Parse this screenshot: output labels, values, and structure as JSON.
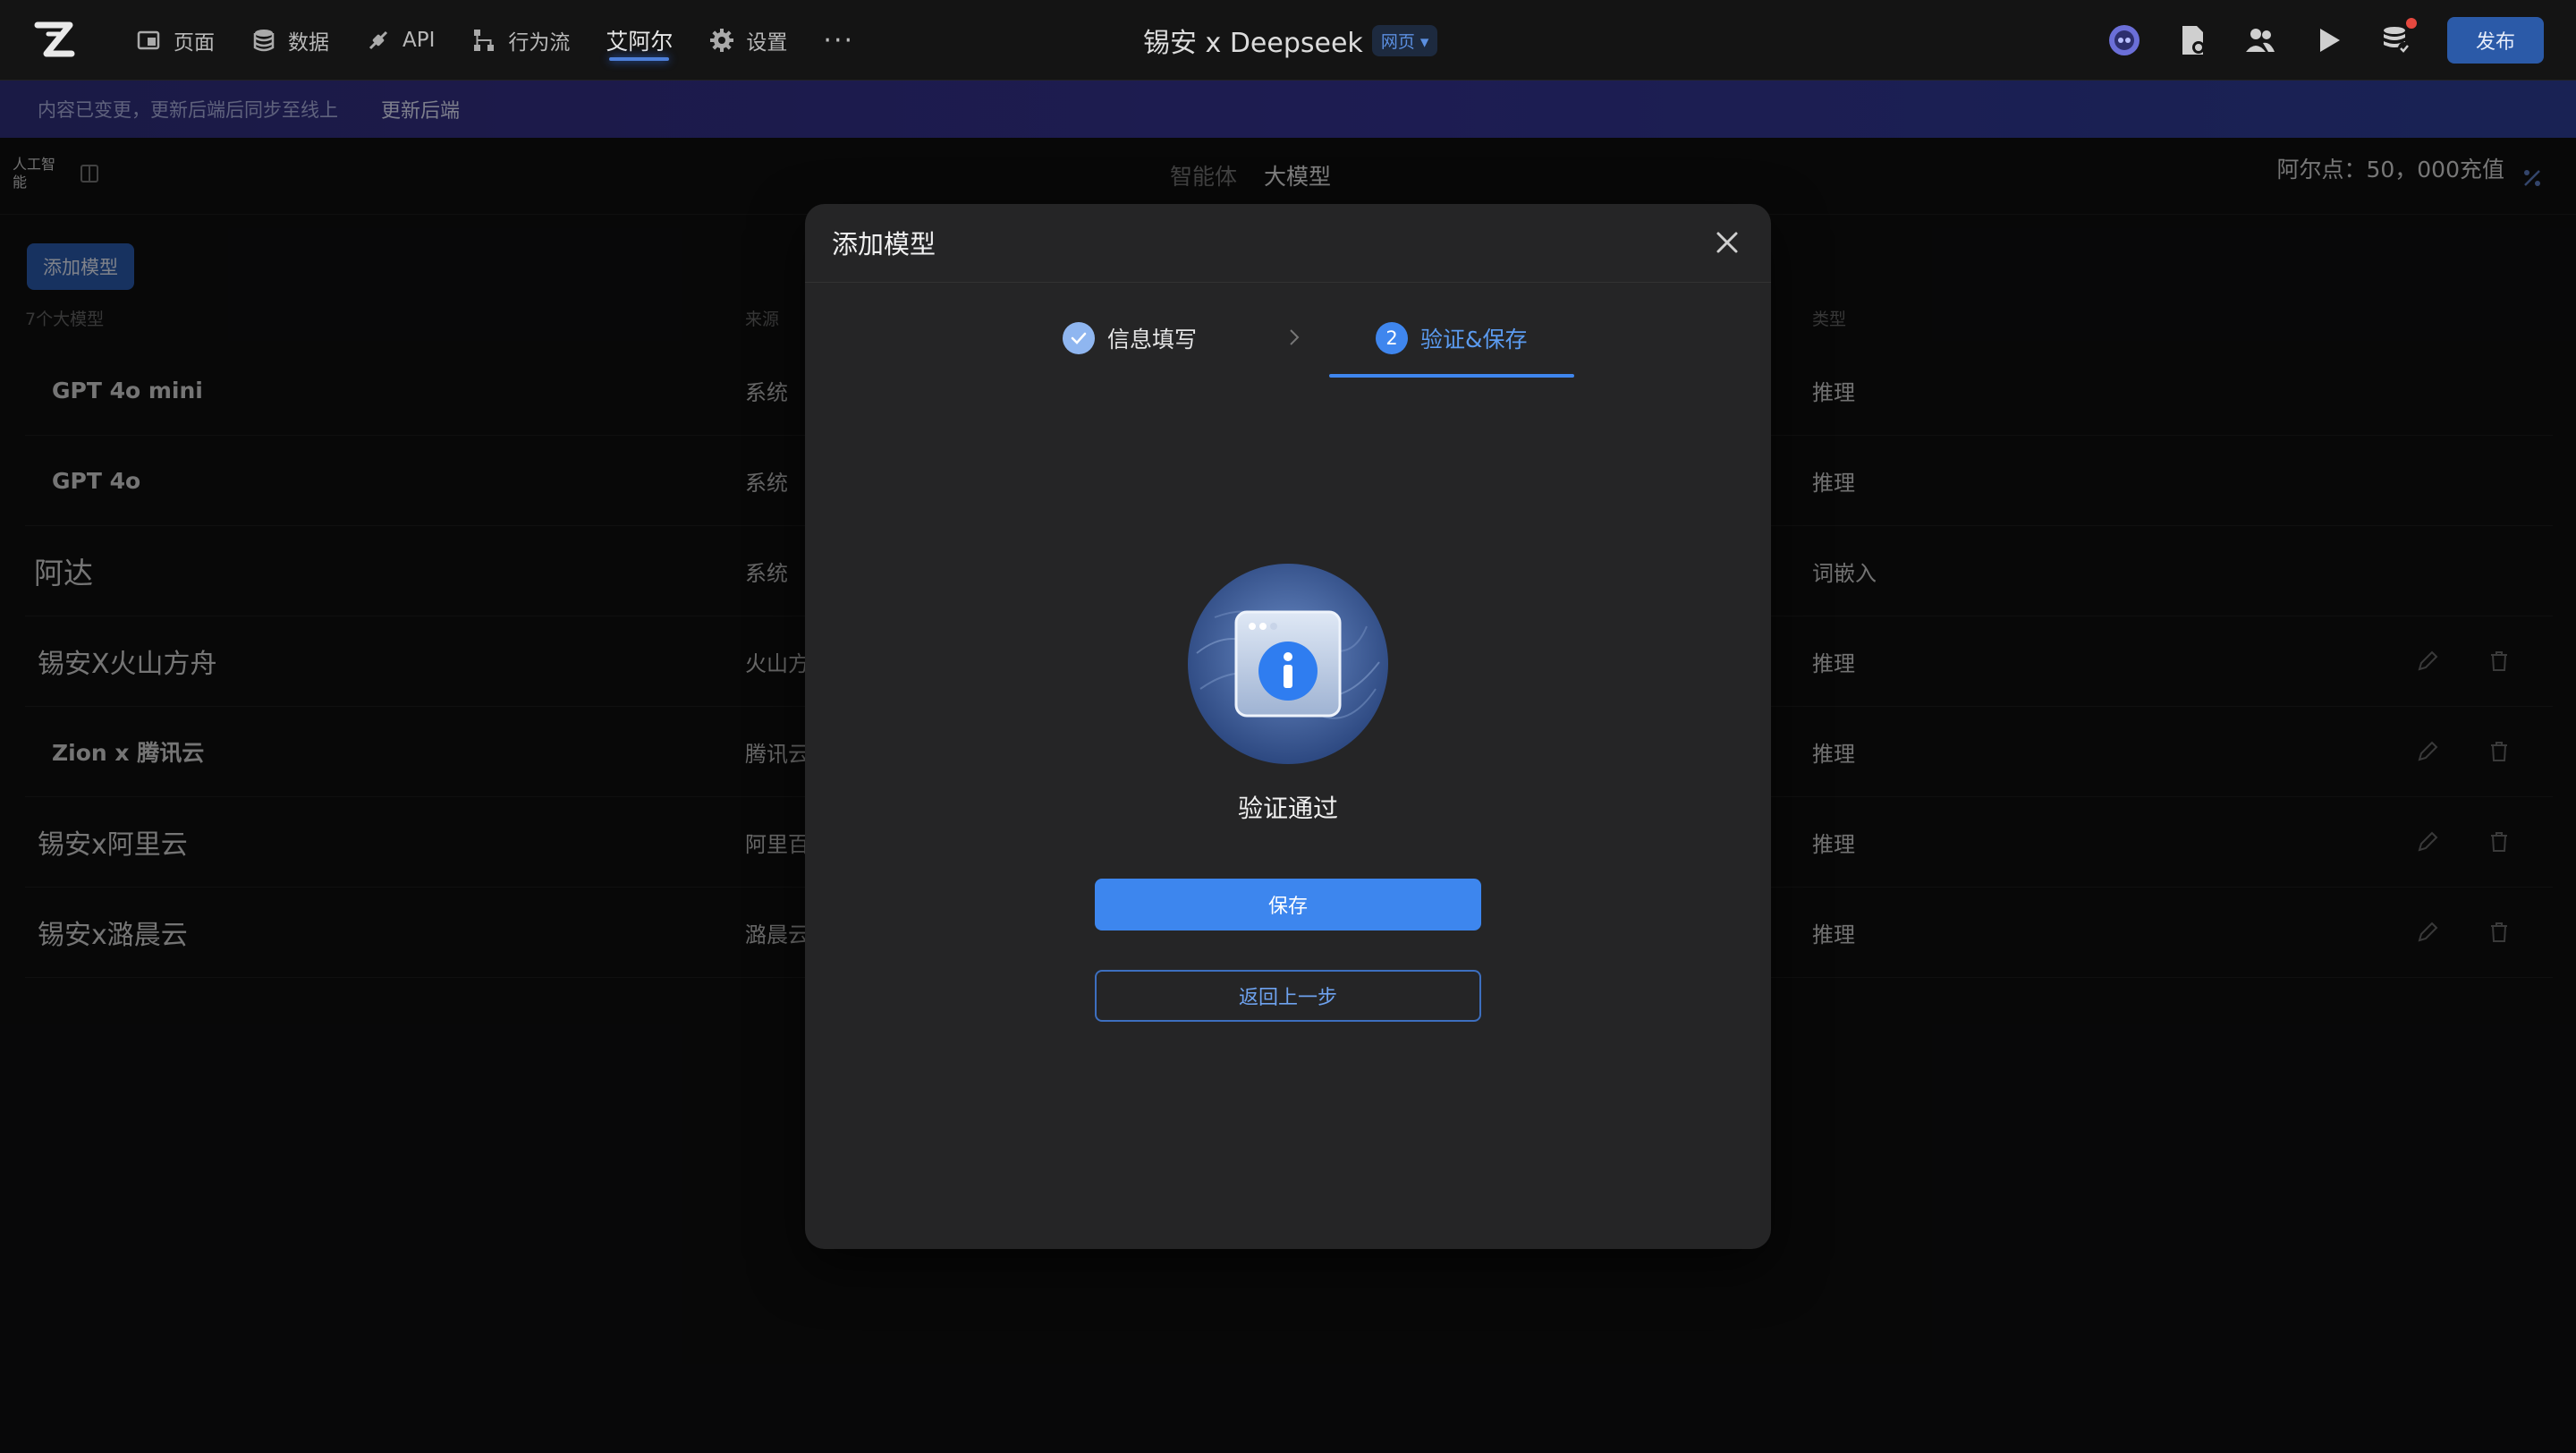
{
  "topbar": {
    "logo_icon": "z-logo-icon",
    "nav": [
      {
        "label": "页面",
        "icon": "page-icon"
      },
      {
        "label": "数据",
        "icon": "database-icon"
      },
      {
        "label": "API",
        "icon": "api-icon"
      },
      {
        "label": "行为流",
        "icon": "flow-icon"
      },
      {
        "label": "艾阿尔",
        "icon": ""
      },
      {
        "label": "设置",
        "icon": "gear-icon"
      }
    ],
    "more": "···",
    "doc_title": "锡安 x Deepseek",
    "doc_badge": "网页 ▾",
    "publish": "发布"
  },
  "banner": {
    "message": "内容已变更，更新后端后同步至线上",
    "action": "更新后端"
  },
  "subheader": {
    "ai_label": "人工智能",
    "tabs": [
      "智能体",
      "大模型"
    ],
    "active_tab": "大模型",
    "points": "阿尔点：50，000充值"
  },
  "content": {
    "add_button": "添加模型",
    "count": "7个大模型",
    "col_source": "来源",
    "col_type": "类型",
    "rows": [
      {
        "name": "GPT 4o mini",
        "source": "系统",
        "type": "推理",
        "editable": false
      },
      {
        "name": "GPT 4o",
        "source": "系统",
        "type": "推理",
        "editable": false
      },
      {
        "name": "阿达",
        "source": "系统",
        "type": "词嵌入",
        "editable": false
      },
      {
        "name": "锡安X火山方舟",
        "source": "火山方",
        "type": "推理",
        "editable": true
      },
      {
        "name": "Zion x 腾讯云",
        "source": "腾讯云",
        "type": "推理",
        "editable": true
      },
      {
        "name": "锡安x阿里云",
        "source": "阿里百",
        "type": "推理",
        "editable": true
      },
      {
        "name": "锡安x潞晨云",
        "source": "潞晨云",
        "type": "推理",
        "editable": true
      }
    ]
  },
  "modal": {
    "title": "添加模型",
    "steps": [
      {
        "label": "信息填写",
        "state": "done"
      },
      {
        "label": "验证&保存",
        "state": "active",
        "number": "2"
      }
    ],
    "status": "验证通过",
    "save": "保存",
    "back": "返回上一步"
  },
  "colors": {
    "accent": "#3d86ee",
    "banner": "#34338f",
    "background": "#0f0f10",
    "modal": "#252526"
  }
}
